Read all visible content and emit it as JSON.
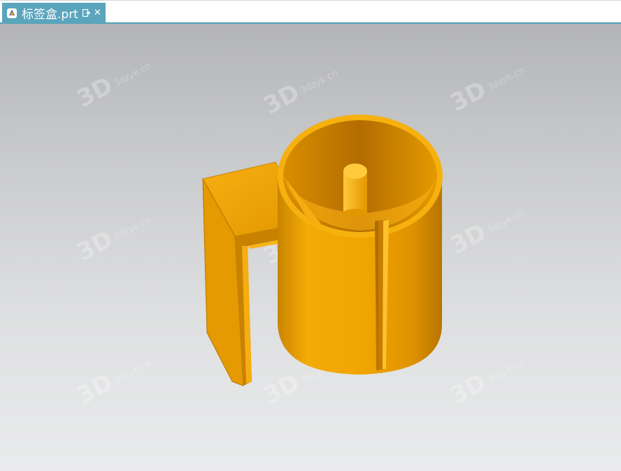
{
  "tab": {
    "file_name": "标签盒.prt",
    "icon": "nx-part-icon",
    "dock_icon": "undock-icon",
    "close_icon": "close-icon"
  },
  "watermark": {
    "mark": "3D",
    "site": "3dzyk.cn"
  },
  "model": {
    "color": "#f0a400",
    "shadow_color": "#b96f00",
    "highlight_color": "#ffd04a"
  },
  "colors": {
    "tab_background": "#5aa5bd",
    "tab_underline": "#4fa0b6"
  }
}
